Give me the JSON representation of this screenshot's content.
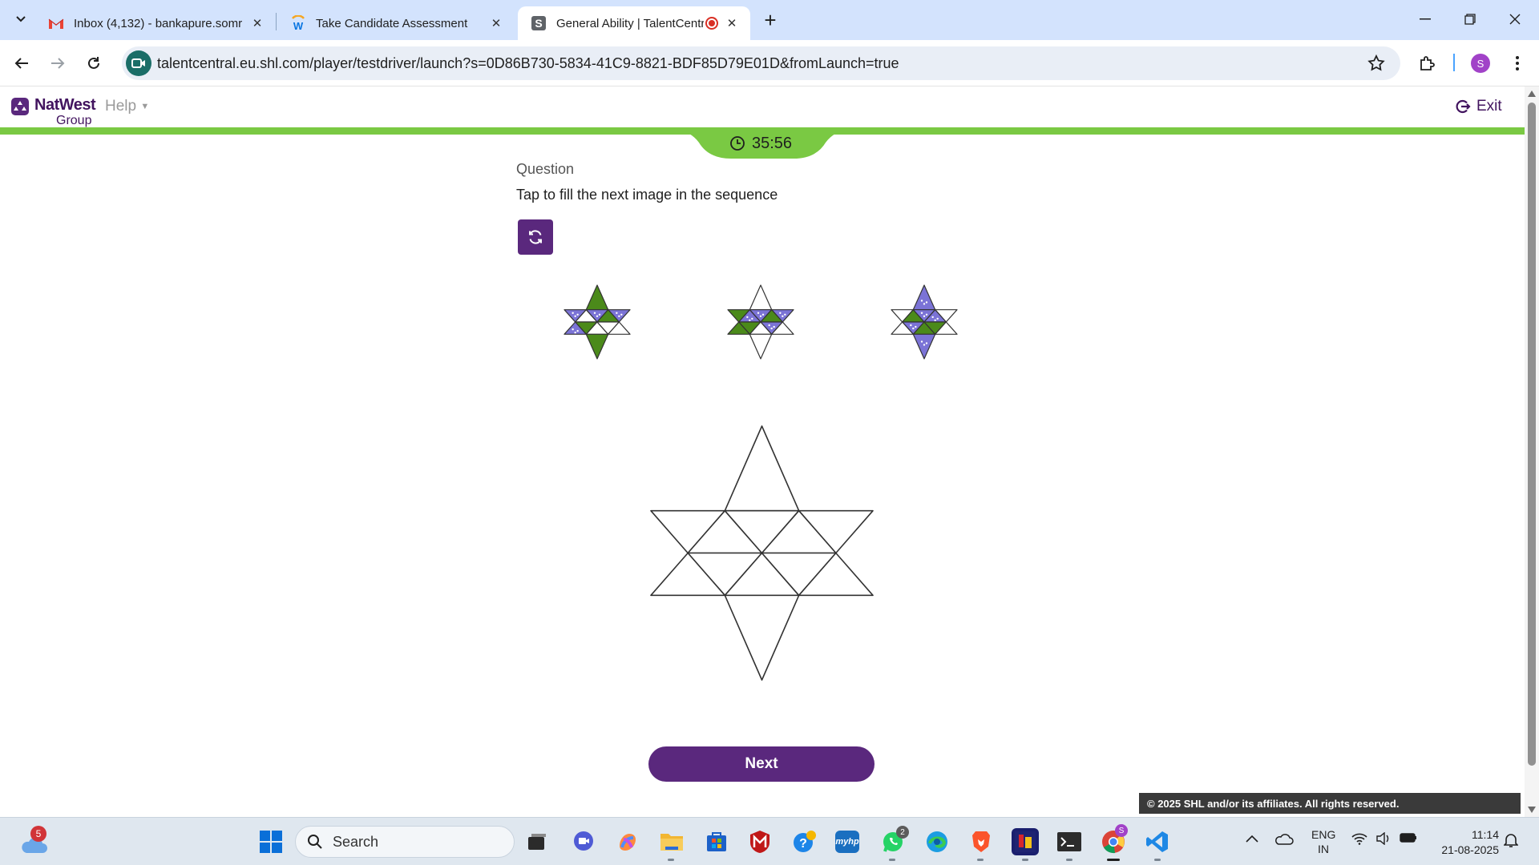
{
  "browser": {
    "tabs": [
      {
        "title": "Inbox (4,132) - bankapure.somr",
        "icon": "gmail-icon"
      },
      {
        "title": "Take Candidate Assessment",
        "icon": "workday-icon"
      },
      {
        "title": "General Ability | TalentCentr",
        "icon": "shl-icon",
        "active": true,
        "recording": true
      }
    ],
    "url": "talentcentral.eu.shl.com/player/testdriver/launch?s=0D86B730-5834-41C9-8821-BDF85D79E01D&fromLaunch=true",
    "profile_initial": "S"
  },
  "app": {
    "brand_name": "NatWest",
    "brand_sub": "Group",
    "help_label": "Help",
    "exit_label": "Exit",
    "timer": "35:56",
    "question_label": "Question",
    "question_text": "Tap to fill the next image in the sequence",
    "next_label": "Next",
    "copyright": "© 2025 SHL and/or its affiliates. All rights reserved."
  },
  "puzzle": {
    "colors": {
      "green": "#4b8a1a",
      "purple": "#7b73d6",
      "outline": "#333333"
    },
    "triangle_order": [
      "top-point",
      "upper-left",
      "upper-center",
      "upper-right",
      "center",
      "lower-left",
      "lower-center",
      "lower-right",
      "bottom-point",
      "left-point",
      "right-point"
    ],
    "sequence": [
      {
        "top-point": "green",
        "upper-left": "white",
        "upper-center": "purple",
        "upper-right": "green",
        "center": "white",
        "lower-left": "green",
        "lower-center": "purple",
        "lower-right": "white",
        "bottom-point": "green",
        "left-point": "purple",
        "right-point": "purple"
      },
      {
        "top-point": "white",
        "upper-left": "purple",
        "upper-center": "purple",
        "upper-right": "green",
        "center": "white",
        "lower-left": "green",
        "lower-center": "green",
        "lower-right": "purple",
        "bottom-point": "white",
        "left-point": "green",
        "right-point": "purple"
      },
      {
        "top-point": "purple",
        "upper-left": "green",
        "upper-center": "purple",
        "upper-right": "purple",
        "center": "green",
        "lower-left": "purple",
        "lower-center": "white",
        "lower-right": "green",
        "bottom-point": "purple",
        "left-point": "white",
        "right-point": "white"
      }
    ],
    "answer": "empty"
  },
  "taskbar": {
    "search_placeholder": "Search",
    "weather_badge": "5",
    "whatsapp_badge": "2",
    "chrome_badge": "S",
    "language_line1": "ENG",
    "language_line2": "IN",
    "time": "11:14",
    "date": "21-08-2025"
  }
}
